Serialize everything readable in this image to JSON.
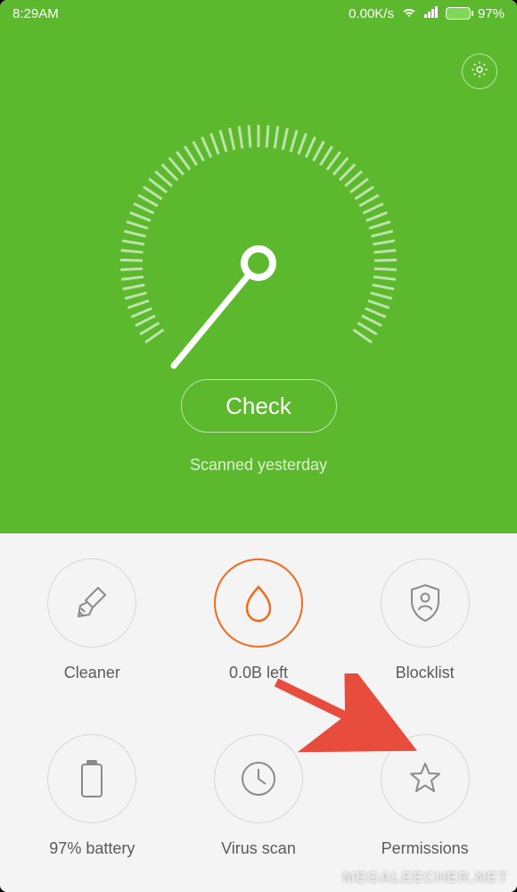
{
  "statusBar": {
    "time": "8:29AM",
    "netSpeed": "0.00K/s",
    "batteryPercent": "97%"
  },
  "hero": {
    "checkLabel": "Check",
    "scanStatus": "Scanned yesterday"
  },
  "grid": {
    "items": [
      {
        "label": "Cleaner"
      },
      {
        "label": "0.0B left"
      },
      {
        "label": "Blocklist"
      },
      {
        "label": "97% battery"
      },
      {
        "label": "Virus scan"
      },
      {
        "label": "Permissions"
      }
    ]
  },
  "watermark": "MEGALEECHER.NET"
}
